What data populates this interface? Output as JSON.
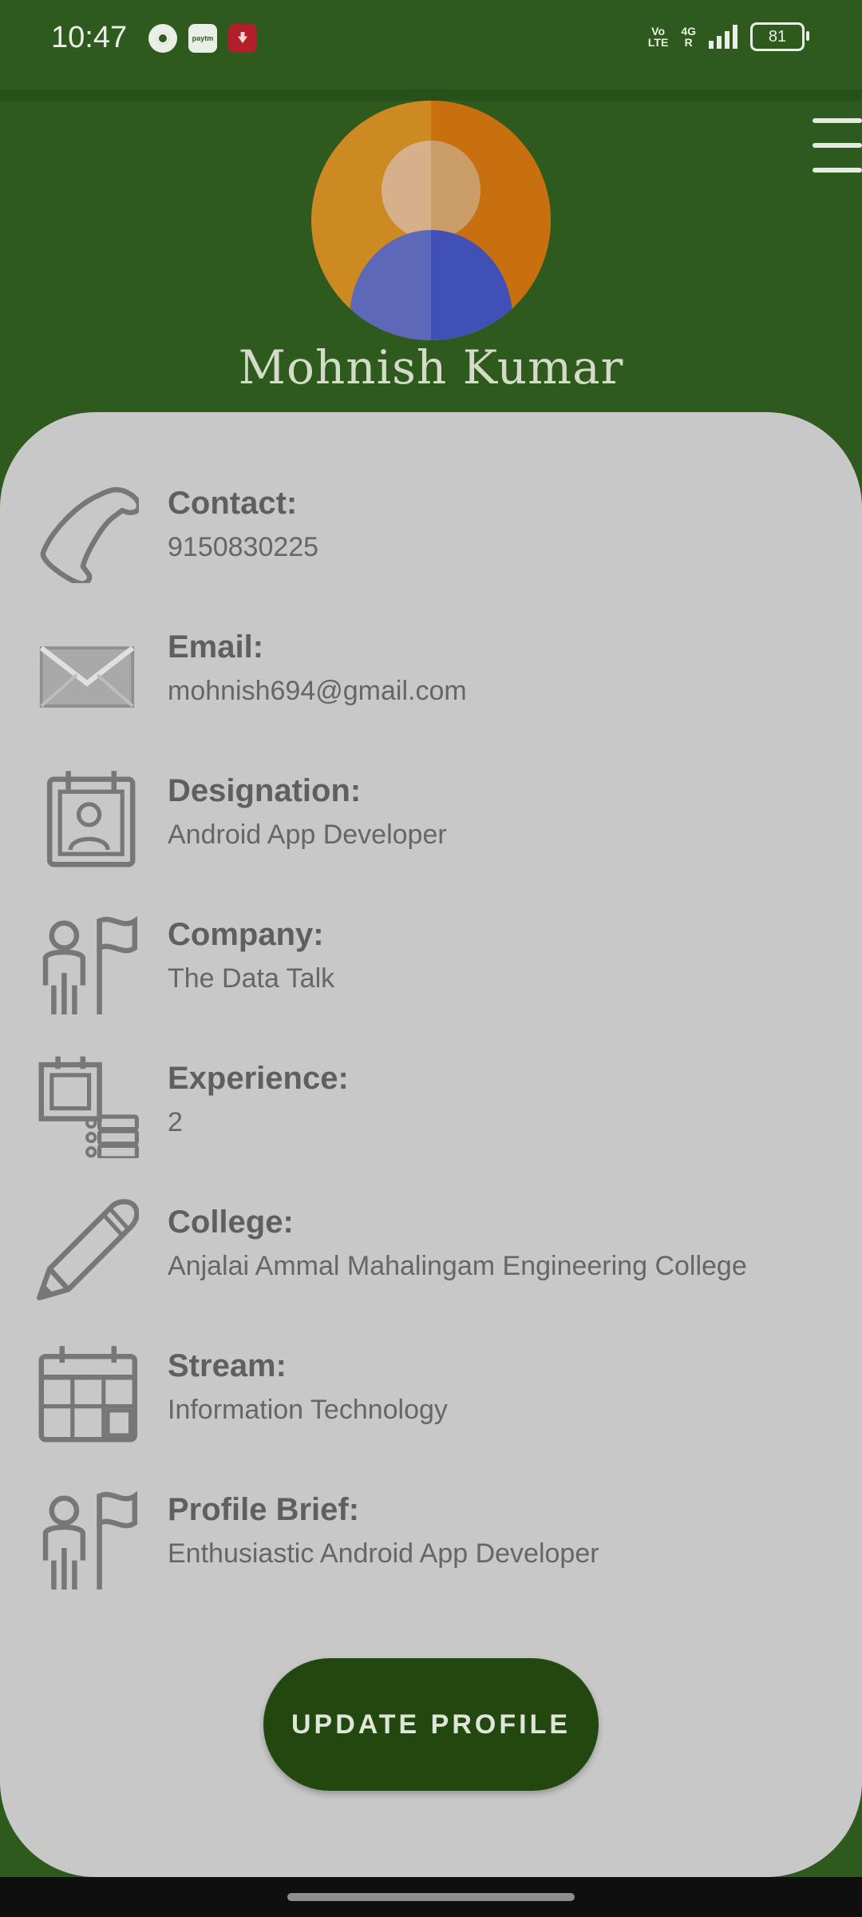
{
  "status_bar": {
    "time": "10:47",
    "left_icons": [
      "chrome-icon",
      "paytm-icon",
      "download-icon"
    ],
    "network_label_top": "Vo",
    "network_label_bottom": "LTE",
    "network_type": "4G",
    "network_r": "R",
    "battery": "81"
  },
  "header": {
    "name": "Mohnish Kumar",
    "menu_icon": "hamburger-menu-icon"
  },
  "profile_fields": [
    {
      "label": "Contact:",
      "value": "9150830225",
      "icon": "phone-icon"
    },
    {
      "label": "Email:",
      "value": "mohnish694@gmail.com",
      "icon": "envelope-icon"
    },
    {
      "label": "Designation:",
      "value": "Android App Developer",
      "icon": "id-badge-icon"
    },
    {
      "label": "Company:",
      "value": "The Data Talk",
      "icon": "person-flag-icon"
    },
    {
      "label": "Experience:",
      "value": "2",
      "icon": "notes-list-icon"
    },
    {
      "label": "College:",
      "value": "Anjalai Ammal Mahalingam Engineering College",
      "icon": "pencil-icon"
    },
    {
      "label": "Stream:",
      "value": "Information Technology",
      "icon": "calendar-grid-icon"
    },
    {
      "label": "Profile Brief:",
      "value": "Enthusiastic Android App Developer",
      "icon": "person-flag-icon"
    }
  ],
  "actions": {
    "update_label": "UPDATE PROFILE"
  },
  "colors": {
    "header_bg": "#2f5a1e",
    "card_bg": "#c8c8c8",
    "button_bg": "#22470f"
  }
}
